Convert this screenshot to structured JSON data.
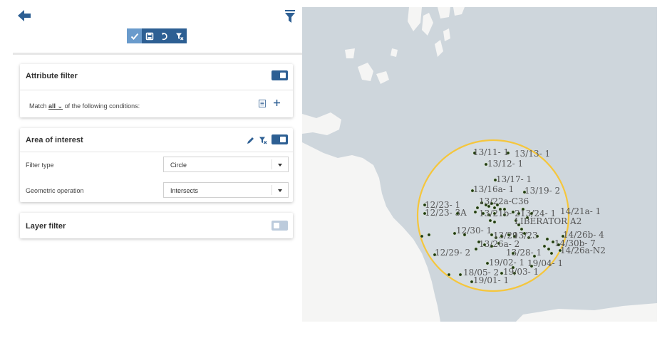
{
  "toolbar": {
    "apply_icon": "check-icon",
    "save_icon": "save-icon",
    "reset_icon": "undo-icon",
    "clear_icon": "clear-filter-icon"
  },
  "attribute_filter": {
    "title": "Attribute filter",
    "toggle_on": true,
    "match_prefix": "Match",
    "match_value": "all",
    "match_suffix": "of the following conditions:"
  },
  "area_of_interest": {
    "title": "Area of interest",
    "toggle_on": true,
    "filter_type": {
      "label": "Filter type",
      "value": "Circle"
    },
    "geometric_operation": {
      "label": "Geometric operation",
      "value": "Intersects"
    }
  },
  "layer_filter": {
    "title": "Layer filter",
    "toggle_on": false
  },
  "colors": {
    "primary": "#2d5f93",
    "circle": "#f5c63c",
    "sea": "#ced6dc",
    "land": "#f5f5f4",
    "point": "#1f3a10"
  },
  "map": {
    "well_labels": [
      "13/11- 1",
      "13/13- 1",
      "13/12- 1",
      "13/17- 1",
      "13/16a- 1",
      "13/19- 2",
      "13/22a-C36",
      "12/23- 1",
      "12/23- 3A",
      "13/21b- 2",
      "13/24- 1",
      "14/21a- 1",
      "LIBERATOR A2",
      "12/30- 1",
      "13/29",
      "13/23",
      "14/26b- 4",
      "13/26a- 2",
      "14/30b- 7",
      "12/29- 2",
      "13/28- 1",
      "14/26a-N2",
      "19/02- 1",
      "19/04- 1",
      "18/05- 2",
      "19/03- 1",
      "19/01- 1"
    ]
  }
}
